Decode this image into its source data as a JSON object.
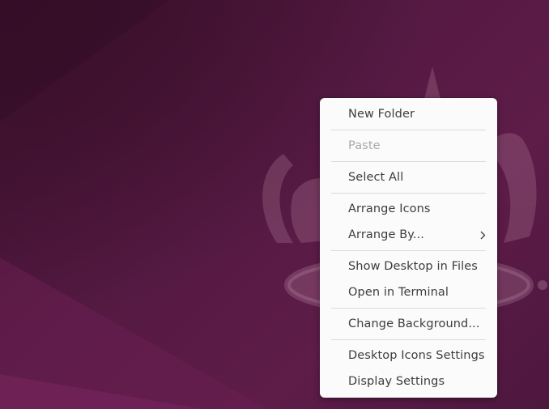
{
  "desktop": {
    "background_colors": {
      "primary": "#561a43",
      "dark": "#3a0f2a",
      "light": "#6e2156",
      "mascot_tint": "#b9849f"
    },
    "wallpaper_icon": "ubuntu-mascot-icon"
  },
  "context_menu": {
    "items": [
      {
        "label": "New Folder",
        "enabled": true
      },
      {
        "label": "Paste",
        "enabled": false
      },
      {
        "label": "Select All",
        "enabled": true
      },
      {
        "label": "Arrange Icons",
        "enabled": true
      },
      {
        "label": "Arrange By...",
        "enabled": true,
        "submenu_icon": "chevron-right-icon"
      },
      {
        "label": "Show Desktop in Files",
        "enabled": true
      },
      {
        "label": "Open in Terminal",
        "enabled": true
      },
      {
        "label": "Change Background...",
        "enabled": true
      },
      {
        "label": "Desktop Icons Settings",
        "enabled": true
      },
      {
        "label": "Display Settings",
        "enabled": true
      }
    ]
  }
}
